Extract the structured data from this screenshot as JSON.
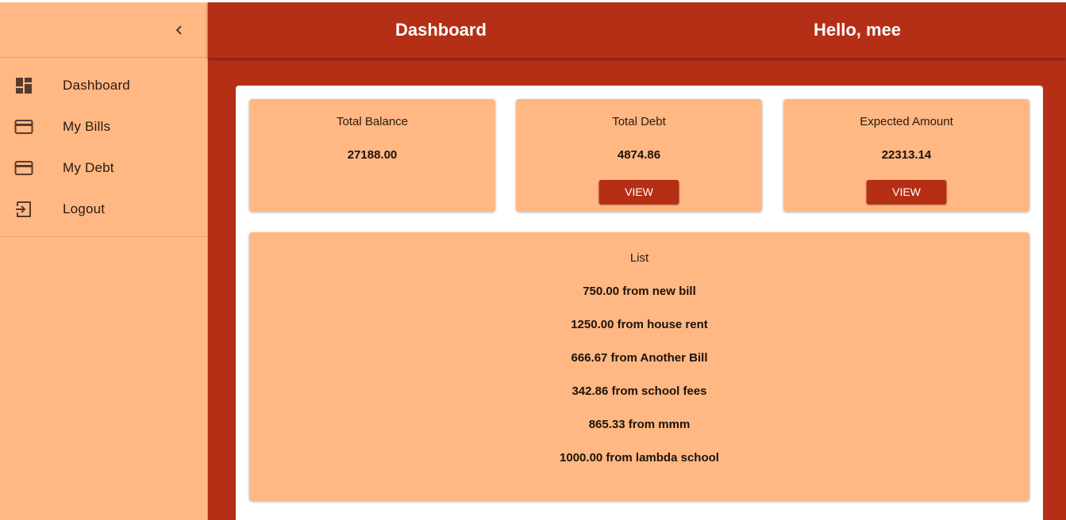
{
  "sidebar": {
    "items": [
      {
        "label": "Dashboard",
        "icon": "dashboard-icon"
      },
      {
        "label": "My Bills",
        "icon": "credit-card-icon"
      },
      {
        "label": "My Debt",
        "icon": "credit-card-icon"
      },
      {
        "label": "Logout",
        "icon": "logout-icon"
      }
    ]
  },
  "header": {
    "title": "Dashboard",
    "greeting": "Hello, mee"
  },
  "cards": [
    {
      "title": "Total Balance",
      "value": "27188.00"
    },
    {
      "title": "Total Debt",
      "value": "4874.86",
      "button": "VIEW"
    },
    {
      "title": "Expected Amount",
      "value": "22313.14",
      "button": "VIEW"
    }
  ],
  "list": {
    "title": "List",
    "items": [
      "750.00 from new bill",
      "1250.00 from house rent",
      "666.67 from Another Bill",
      "342.86 from school fees",
      "865.33 from mmm",
      "1000.00 from lambda school"
    ]
  },
  "colors": {
    "primary": "#b52f17",
    "surface": "#ffb883",
    "panel": "#ffffff"
  }
}
